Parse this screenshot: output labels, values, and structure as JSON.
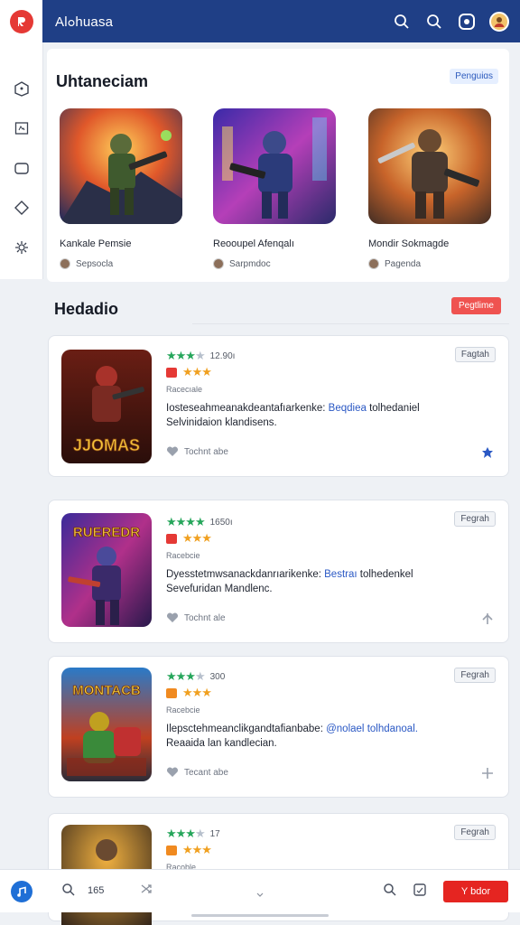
{
  "app": {
    "title": "Alߋhuasa"
  },
  "topbar": {
    "icons": [
      "search-icon",
      "search-icon",
      "notifications-icon",
      "profile-avatar"
    ]
  },
  "sidebar": {
    "icons": [
      "home-icon",
      "library-icon",
      "folder-icon",
      "tag-icon",
      "settings-icon"
    ]
  },
  "featured": {
    "title": "Uhtaneciam",
    "pill": "Penguiɑs",
    "cards": [
      {
        "name": "Kankale Pemsie",
        "meta": "Sepsocla"
      },
      {
        "name": "Reooupel Afenqalı",
        "meta": "Sarpmdoc"
      },
      {
        "name": "Mondir Sokmagde",
        "meta": "Pagenda"
      }
    ]
  },
  "recommended": {
    "title": "Hedadio",
    "pill": "Pegtlime"
  },
  "list": [
    {
      "art_title": "JJOMAS",
      "rating": "12.90ı",
      "category": "Racecıale",
      "desc_a": "Iosteseahmeanakdeantafıarkenke:",
      "desc_hl": "Beqdiea",
      "desc_b": "tolhedaniel",
      "desc_c": "Selvinidaion klandisens.",
      "footer": "Tochnt abe",
      "pill": "Fagtah"
    },
    {
      "art_title": "RUEREDR",
      "rating": "1650ı",
      "category": "Racebcie",
      "desc_a": "Dyesstetmwsanackdanrıarikenke:",
      "desc_hl": "Bestraı",
      "desc_b": "tolhedenkel",
      "desc_c": "Sevefuridan Mandlenc.",
      "footer": "Tochnt ale",
      "pill": "Fegrah"
    },
    {
      "art_title": "MONTACB",
      "rating": "300",
      "category": "Racebcie",
      "desc_a": "Ilepsctehmeanclikgandtafianbabe:",
      "desc_hl": "@nolael",
      "desc_b": "tolhdanoal.",
      "desc_c": "Reaaida lan kandlecian.",
      "footer": "Tecant abe",
      "pill": "Fegrah"
    },
    {
      "art_title": "",
      "rating": "17",
      "category": "Racoble",
      "desc_a": "",
      "desc_hl": "",
      "desc_b": "",
      "desc_c": "",
      "footer": "",
      "pill": "Fegrah"
    }
  ],
  "bottombar": {
    "count": "165",
    "button": "Y bdor"
  },
  "colors": {
    "topbar": "#1f3f86",
    "accent_red": "#e52521",
    "accent_blue": "#1f6fd6",
    "star_green": "#26a65b",
    "star_orange": "#f0a020"
  }
}
